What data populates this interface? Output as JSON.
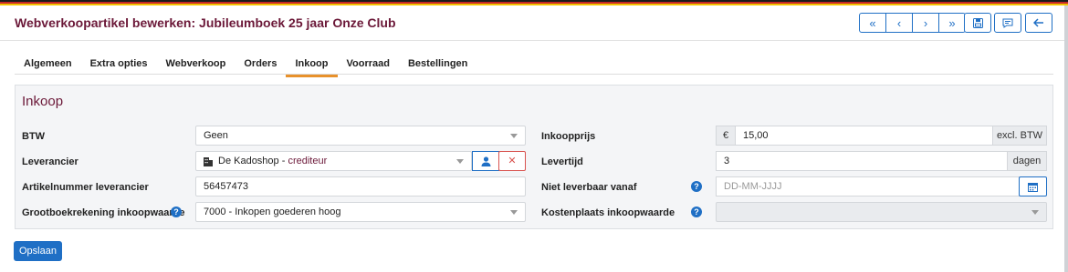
{
  "colors": {
    "accent": "#1f6fc5",
    "title": "#6b1838",
    "tab_active": "#e8912b",
    "flag": [
      "#1a1a1a",
      "#c62828",
      "#f2c200"
    ]
  },
  "header": {
    "title": "Webverkoopartikel bewerken: Jubileumboek 25 jaar Onze Club",
    "nav_icons": [
      "first-icon",
      "prev-icon",
      "next-icon",
      "last-icon"
    ],
    "actions": [
      "save-icon",
      "comment-icon",
      "back-icon"
    ]
  },
  "tabs": [
    "Algemeen",
    "Extra opties",
    "Webverkoop",
    "Orders",
    "Inkoop",
    "Voorraad",
    "Bestellingen"
  ],
  "active_tab": "Inkoop",
  "panel": {
    "title": "Inkoop",
    "btw": {
      "label": "BTW",
      "value": "Geen"
    },
    "leverancier": {
      "label": "Leverancier",
      "value": "De Kadoshop",
      "sep": " - ",
      "type": "crediteur"
    },
    "artikelnummer": {
      "label": "Artikelnummer leverancier",
      "value": "56457473"
    },
    "grootboek": {
      "label": "Grootboekrekening inkoopwaarde",
      "value": "7000 - Inkopen goederen hoog"
    },
    "inkoopprijs": {
      "label": "Inkoopprijs",
      "currency": "€",
      "value": "15,00",
      "suffix": "excl. BTW"
    },
    "levertijd": {
      "label": "Levertijd",
      "value": "3",
      "suffix": "dagen"
    },
    "niet_leverbaar": {
      "label": "Niet leverbaar vanaf",
      "placeholder": "DD-MM-JJJJ"
    },
    "kostenplaats": {
      "label": "Kostenplaats inkoopwaarde",
      "value": ""
    }
  },
  "save_label": "Opslaan"
}
